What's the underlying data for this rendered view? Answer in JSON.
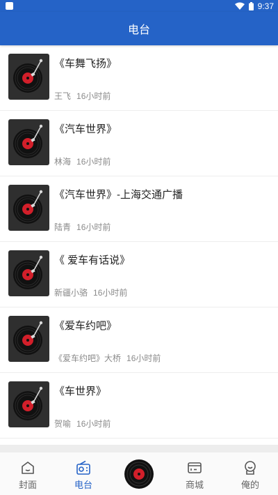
{
  "status": {
    "time": "9:37",
    "left_icon": "square-notification-icon",
    "wifi_icon": "wifi-icon",
    "battery_icon": "battery-icon"
  },
  "header": {
    "title": "电台"
  },
  "list": [
    {
      "title": "《车舞飞扬》",
      "author": "王飞",
      "time": "16小时前"
    },
    {
      "title": "《汽车世界》",
      "author": "林海",
      "time": "16小时前"
    },
    {
      "title": "《汽车世界》-上海交通广播",
      "author": "陆青",
      "time": "16小时前"
    },
    {
      "title": "《 爱车有话说》",
      "author": "新疆小骆",
      "time": "16小时前"
    },
    {
      "title": "《爱车约吧》",
      "author": "《爱车约吧》大桥",
      "time": "16小时前"
    },
    {
      "title": "《车世界》",
      "author": "贺喻",
      "time": "16小时前"
    }
  ],
  "nav": {
    "items": [
      {
        "label": "封面",
        "icon": "home-icon"
      },
      {
        "label": "电台",
        "icon": "radio-icon"
      },
      {
        "label": "",
        "icon": "record-player-icon"
      },
      {
        "label": "商城",
        "icon": "shop-card-icon"
      },
      {
        "label": "俺的",
        "icon": "profile-icon"
      }
    ],
    "active_index": 1
  },
  "colors": {
    "primary": "#2563c7",
    "record_red": "#d21f2a"
  }
}
